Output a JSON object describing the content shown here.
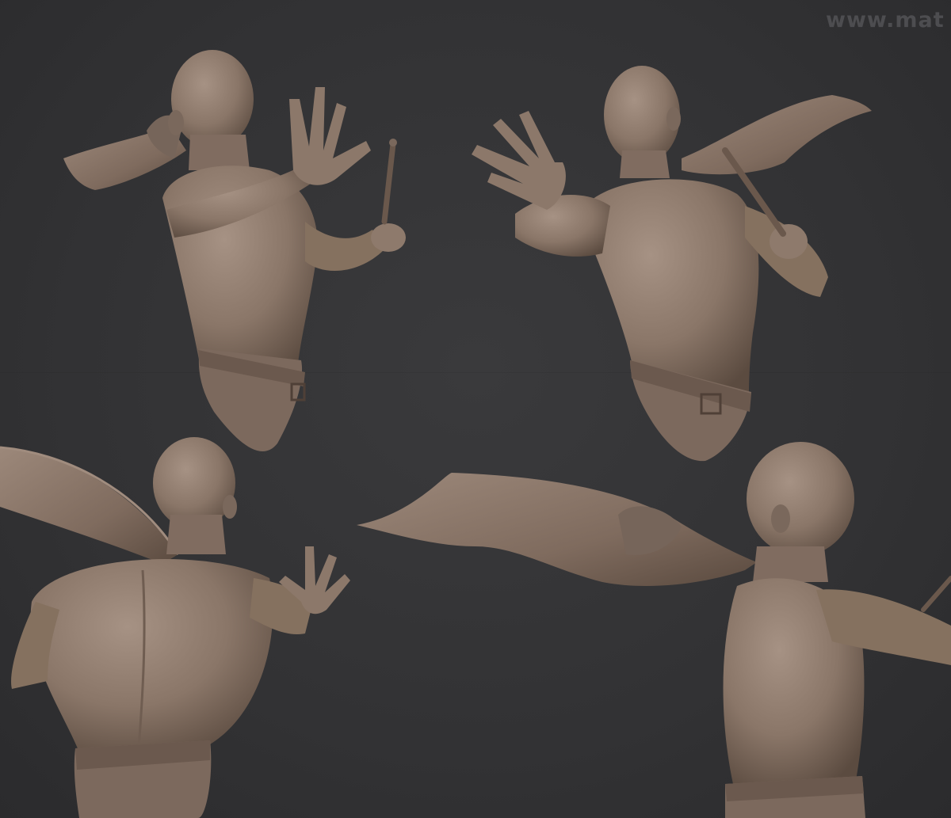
{
  "image": {
    "kind": "3D sculpt turnaround (ZBrush-style clay render)",
    "background_color": "#343436",
    "clay_color": "#8a7668",
    "clay_highlight": "#a69284",
    "clay_shadow": "#5b4b40",
    "views": [
      {
        "name": "front-three-quarter-view"
      },
      {
        "name": "front-right-view"
      },
      {
        "name": "back-view"
      },
      {
        "name": "side-profile-view"
      }
    ]
  },
  "watermark": {
    "text": "www.mat"
  }
}
